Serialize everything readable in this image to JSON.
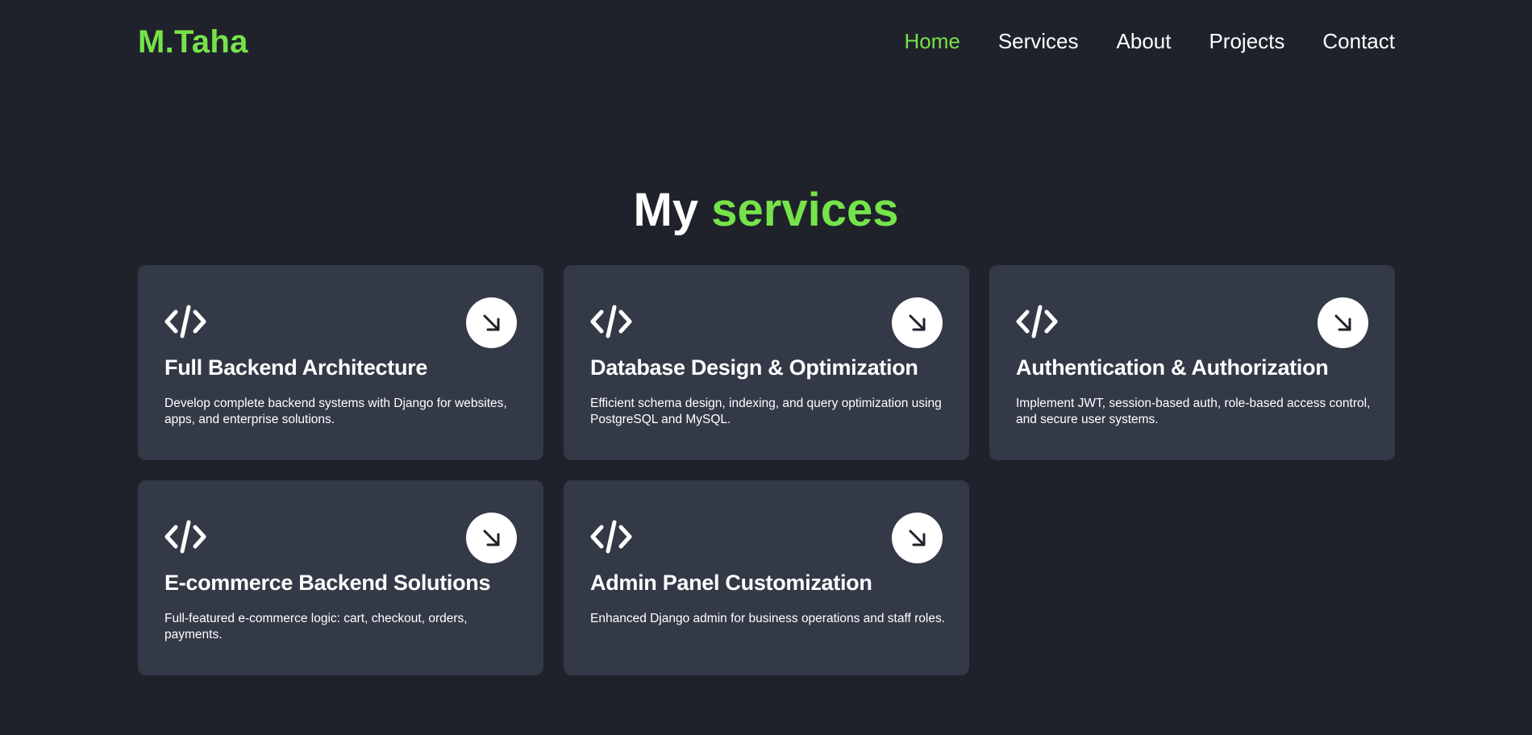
{
  "header": {
    "logo": "M.Taha",
    "nav": [
      {
        "label": "Home",
        "active": true
      },
      {
        "label": "Services",
        "active": false
      },
      {
        "label": "About",
        "active": false
      },
      {
        "label": "Projects",
        "active": false
      },
      {
        "label": "Contact",
        "active": false
      }
    ]
  },
  "services": {
    "title_prefix": "My",
    "title_accent": "services",
    "cards": [
      {
        "icon": "code-icon",
        "title": "Full Backend Architecture",
        "description": "Develop complete backend systems with Django for websites, apps, and enterprise solutions.",
        "action_icon": "arrow-down-right-icon"
      },
      {
        "icon": "code-icon",
        "title": "Database Design & Optimization",
        "description": "Efficient schema design, indexing, and query optimization using PostgreSQL and MySQL.",
        "action_icon": "arrow-down-right-icon"
      },
      {
        "icon": "code-icon",
        "title": "Authentication & Authorization",
        "description": "Implement JWT, session-based auth, role-based access control, and secure user systems.",
        "action_icon": "arrow-down-right-icon"
      },
      {
        "icon": "code-icon",
        "title": "E-commerce Backend Solutions",
        "description": "Full-featured e-commerce logic: cart, checkout, orders, payments.",
        "action_icon": "arrow-down-right-icon"
      },
      {
        "icon": "code-icon",
        "title": "Admin Panel Customization",
        "description": "Enhanced Django admin for business operations and staff roles.",
        "action_icon": "arrow-down-right-icon"
      }
    ]
  },
  "colors": {
    "background": "#1f222b",
    "card": "#333947",
    "accent": "#76e34a",
    "text": "#ffffff"
  }
}
